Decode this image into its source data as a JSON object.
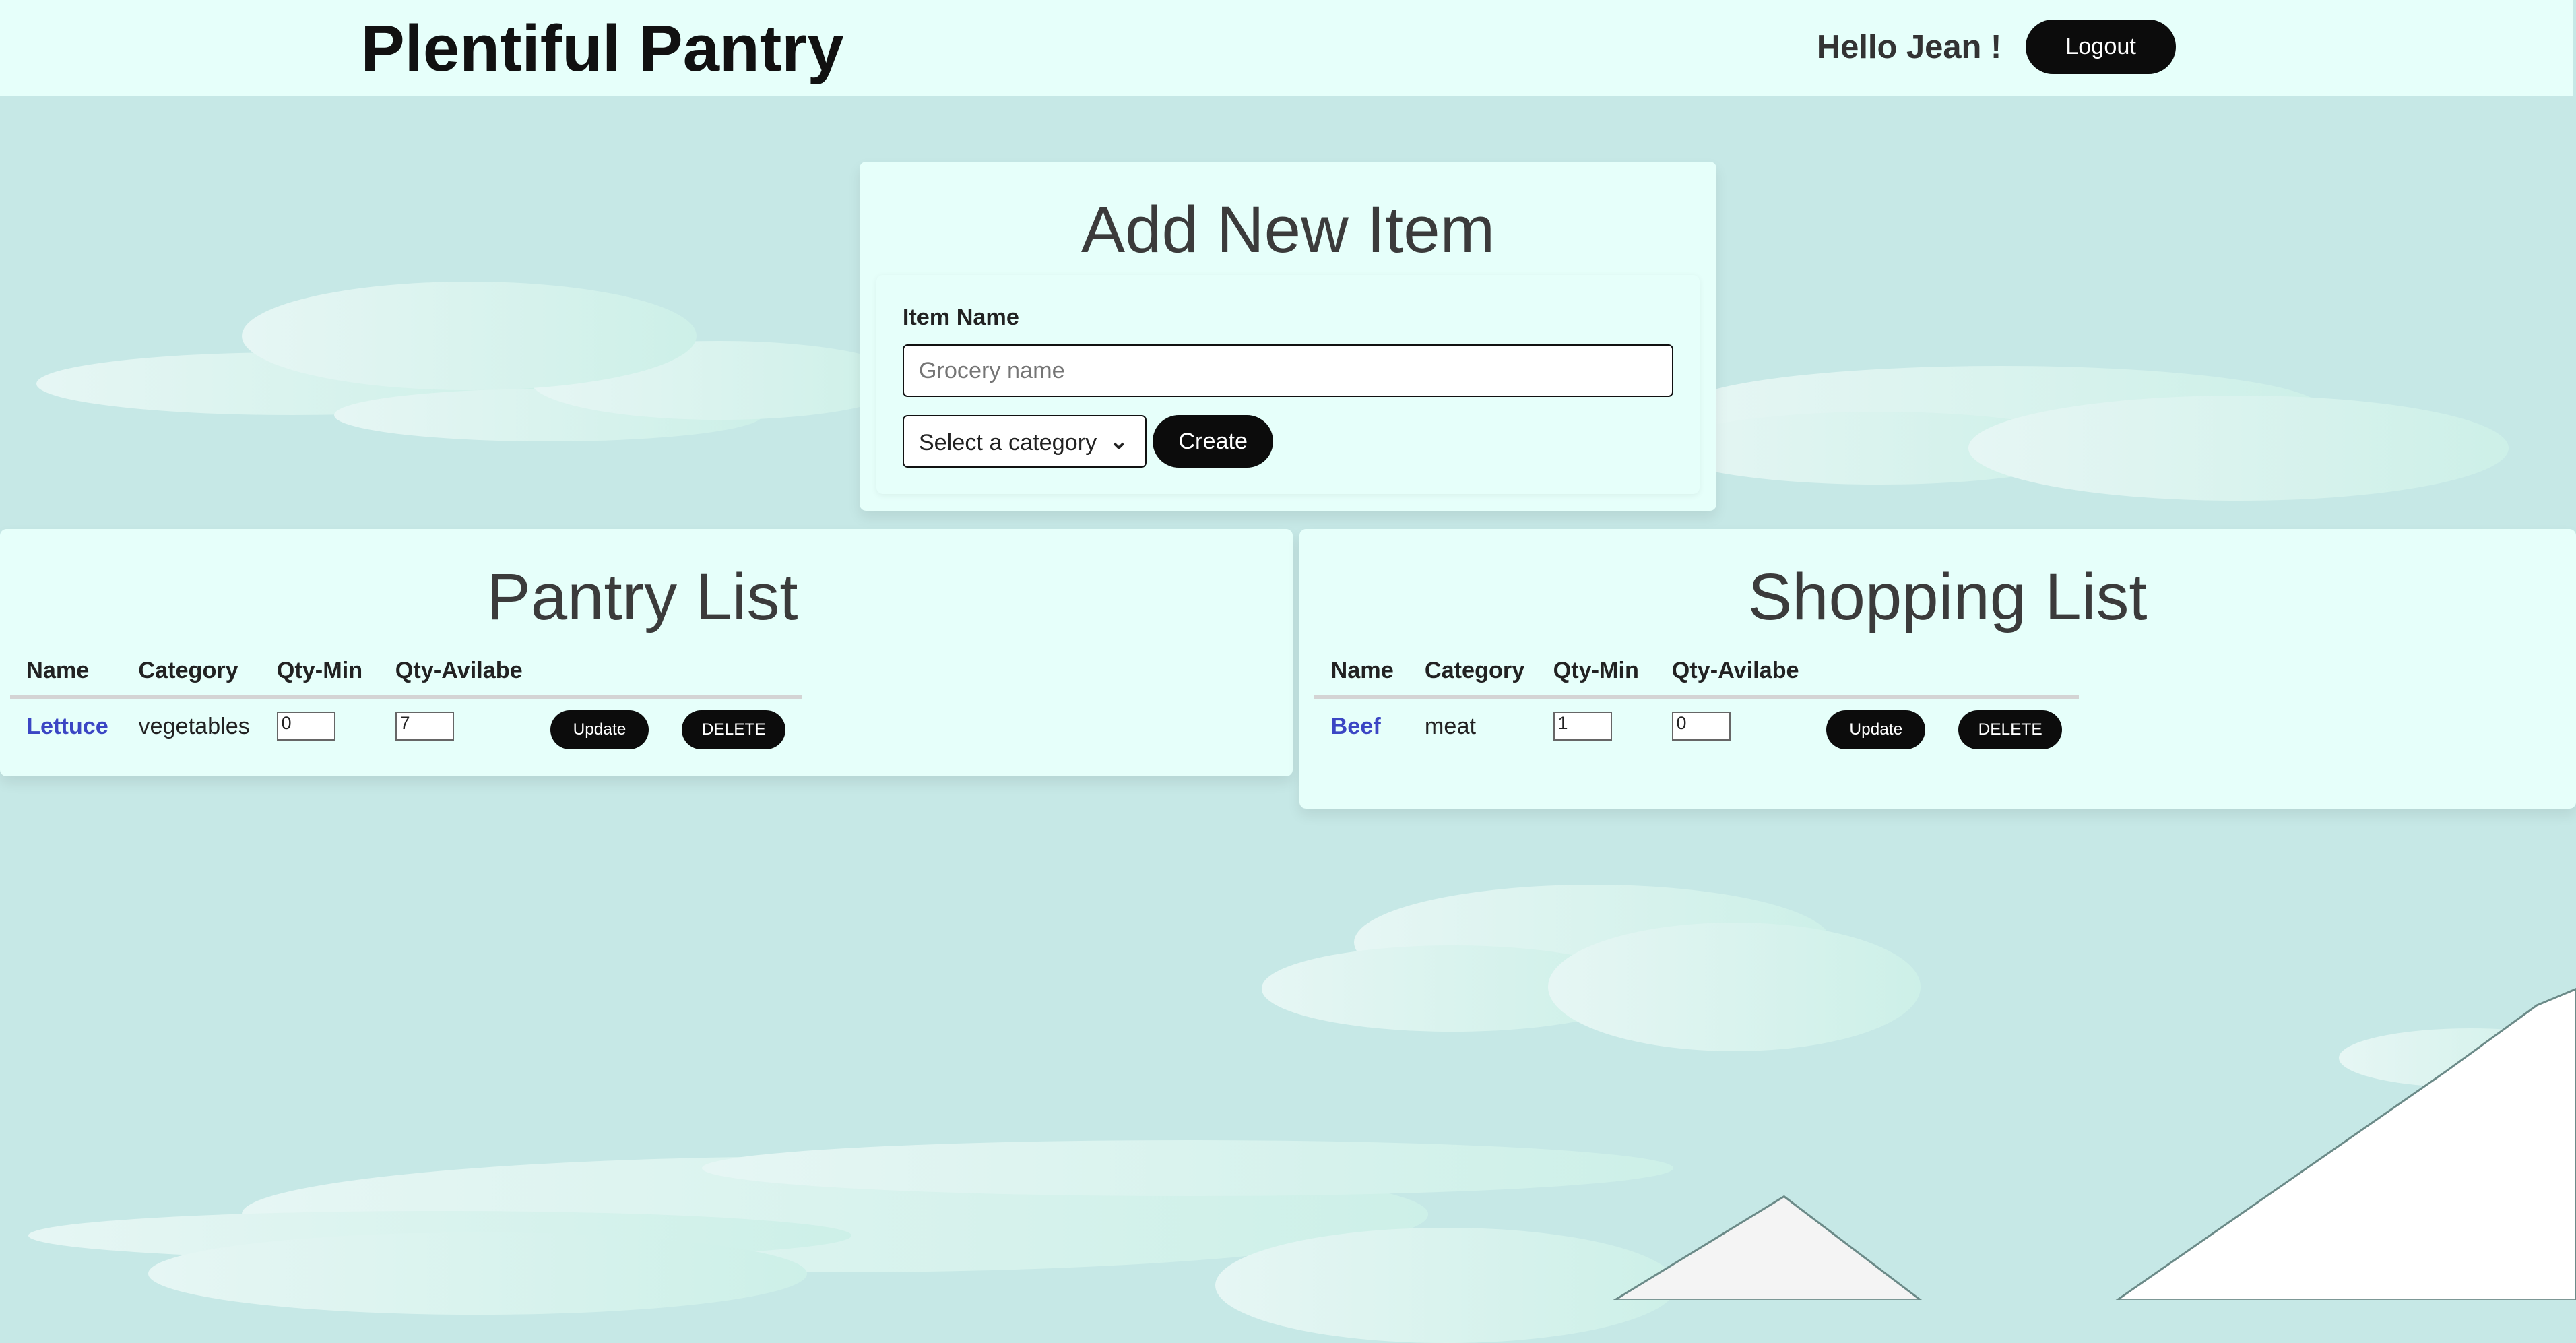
{
  "header": {
    "title": "Plentiful Pantry",
    "greeting": "Hello Jean !",
    "logout_label": "Logout"
  },
  "add_item": {
    "title": "Add New Item",
    "item_name_label": "Item Name",
    "item_name_placeholder": "Grocery name",
    "item_name_value": "",
    "category_selected": "Select a category",
    "create_label": "Create"
  },
  "columns": [
    "Name",
    "Category",
    "Qty-Min",
    "Qty-Avilabe"
  ],
  "pantry": {
    "title": "Pantry List",
    "rows": [
      {
        "name": "Lettuce",
        "category": "vegetables",
        "qty_min": "0",
        "qty_available": "7"
      }
    ],
    "update_label": "Update",
    "delete_label": "DELETE"
  },
  "shopping": {
    "title": "Shopping List",
    "rows": [
      {
        "name": "Beef",
        "category": "meat",
        "qty_min": "1",
        "qty_available": "0"
      }
    ],
    "update_label": "Update",
    "delete_label": "DELETE"
  },
  "colors": {
    "header_bg": "#e6fffa",
    "page_bg": "#c6e8e6",
    "button": "#0c0c0c",
    "link": "#3b46c4"
  }
}
